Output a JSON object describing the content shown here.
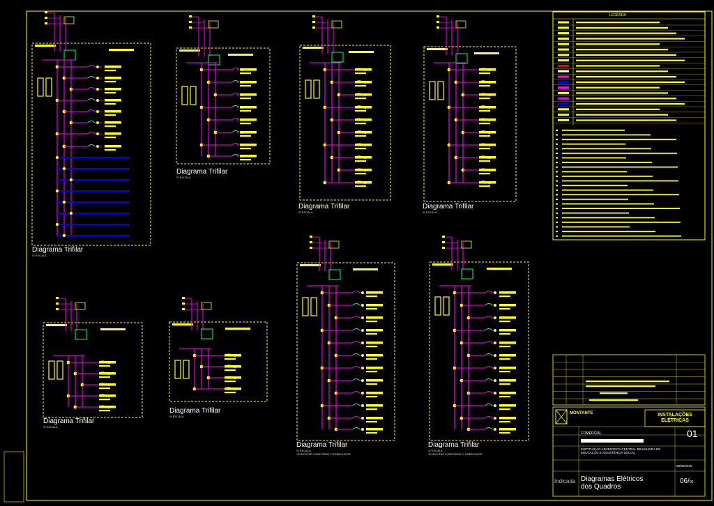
{
  "colors": {
    "background": "#000000",
    "frame": "#ffff00",
    "wire": "#ff00ff",
    "label": "#ffff00",
    "green": "#00ff66",
    "blue": "#0000ff",
    "text": "#ffffff"
  },
  "diagrams": [
    {
      "title": "Diagrama Trifilar",
      "scale": "S/ ESCALA",
      "note": ""
    },
    {
      "title": "Diagrama Trifilar",
      "scale": "S/ ESCALA",
      "note": ""
    },
    {
      "title": "Diagrama Trifilar",
      "scale": "S/ ESCALA",
      "note": ""
    },
    {
      "title": "Diagrama Trifilar",
      "scale": "S/ ESCALA",
      "note": ""
    },
    {
      "title": "Diagrama Trifilar",
      "scale": "S/ ESCALA",
      "note": ""
    },
    {
      "title": "Diagrama Trifilar",
      "scale": "S/ ESCALA",
      "note": ""
    },
    {
      "title": "Diagrama Trifilar",
      "scale": "S/ ESCALA",
      "note": "*EXECUTAR CONFORME O FABRICANTE"
    },
    {
      "title": "Diagrama Trifilar",
      "scale": "S/ ESCALA",
      "note": "*EXECUTAR CONFORME O FABRICANTE"
    }
  ],
  "legend": {
    "title": "LEGENDA"
  },
  "title_block": {
    "company": "MONTANTE",
    "discipline": "INSTALAÇÕES ELÉTRICAS",
    "sheet_number": "01",
    "project_type": "COMERCIAL",
    "owner": "INSTITUIÇÃO ADVENTISTA CENTRAL BRASILEIRA DE EDUCAÇÃO E ASSISTÊNCIA SOCIAL",
    "scale": "Indicada",
    "drawing_title_line1": "Diagramas Elétricos",
    "drawing_title_line2": "dos Quadros",
    "date": "28/05/2019",
    "page": "06/",
    "page_total": "06"
  }
}
